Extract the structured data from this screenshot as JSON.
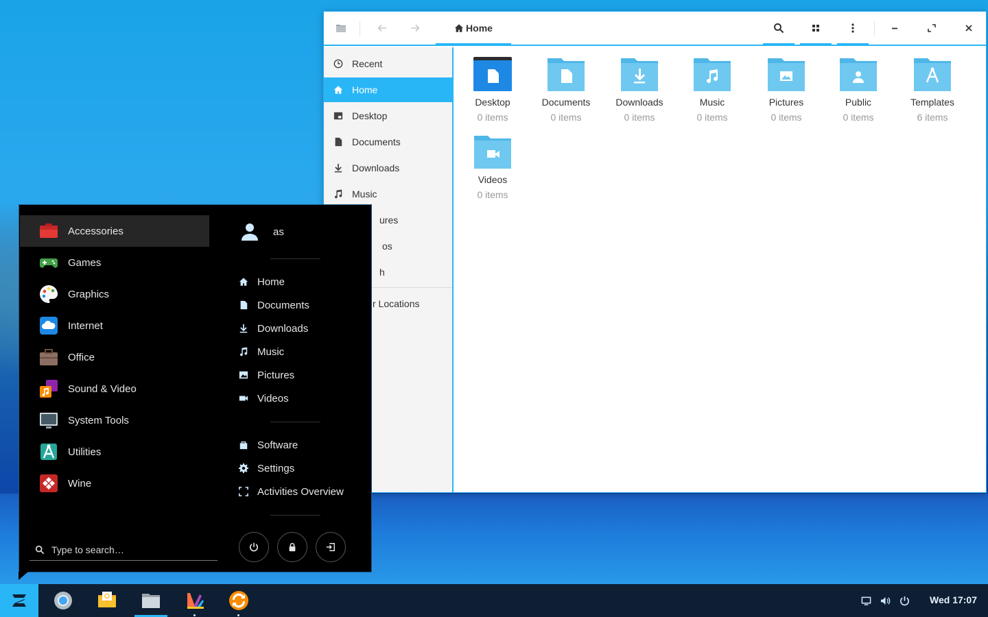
{
  "file_manager": {
    "title": "Home",
    "sidebar": [
      {
        "label": "Recent",
        "icon": "clock-icon"
      },
      {
        "label": "Home",
        "icon": "home-icon",
        "active": true
      },
      {
        "label": "Desktop",
        "icon": "desktop-icon"
      },
      {
        "label": "Documents",
        "icon": "document-icon"
      },
      {
        "label": "Downloads",
        "icon": "download-icon"
      },
      {
        "label": "Music",
        "icon": "music-icon"
      },
      {
        "label": "ures",
        "icon": "pictures-icon"
      },
      {
        "label": "os",
        "icon": "videos-icon"
      },
      {
        "label": "h",
        "icon": "trash-icon"
      }
    ],
    "other_locations": "r Locations",
    "items": [
      {
        "name": "Desktop",
        "count": "0 items",
        "icon": "desktop-folder-icon"
      },
      {
        "name": "Documents",
        "count": "0 items",
        "icon": "documents-folder-icon"
      },
      {
        "name": "Downloads",
        "count": "0 items",
        "icon": "downloads-folder-icon"
      },
      {
        "name": "Music",
        "count": "0 items",
        "icon": "music-folder-icon"
      },
      {
        "name": "Pictures",
        "count": "0 items",
        "icon": "pictures-folder-icon"
      },
      {
        "name": "Public",
        "count": "0 items",
        "icon": "public-folder-icon"
      },
      {
        "name": "Templates",
        "count": "6 items",
        "icon": "templates-folder-icon"
      },
      {
        "name": "Videos",
        "count": "0 items",
        "icon": "videos-folder-icon"
      }
    ],
    "accent": "#29b6f6",
    "folder_color": "#6fc8f0"
  },
  "app_menu": {
    "categories": [
      {
        "label": "Accessories",
        "active": true
      },
      {
        "label": "Games"
      },
      {
        "label": "Graphics"
      },
      {
        "label": "Internet"
      },
      {
        "label": "Office"
      },
      {
        "label": "Sound & Video"
      },
      {
        "label": "System Tools"
      },
      {
        "label": "Utilities"
      },
      {
        "label": "Wine"
      }
    ],
    "user": "as",
    "places": [
      "Home",
      "Documents",
      "Downloads",
      "Music",
      "Pictures",
      "Videos"
    ],
    "system": [
      "Software",
      "Settings",
      "Activities Overview"
    ],
    "search_placeholder": "Type to search…"
  },
  "taskbar": {
    "clock": "Wed 17:07"
  }
}
